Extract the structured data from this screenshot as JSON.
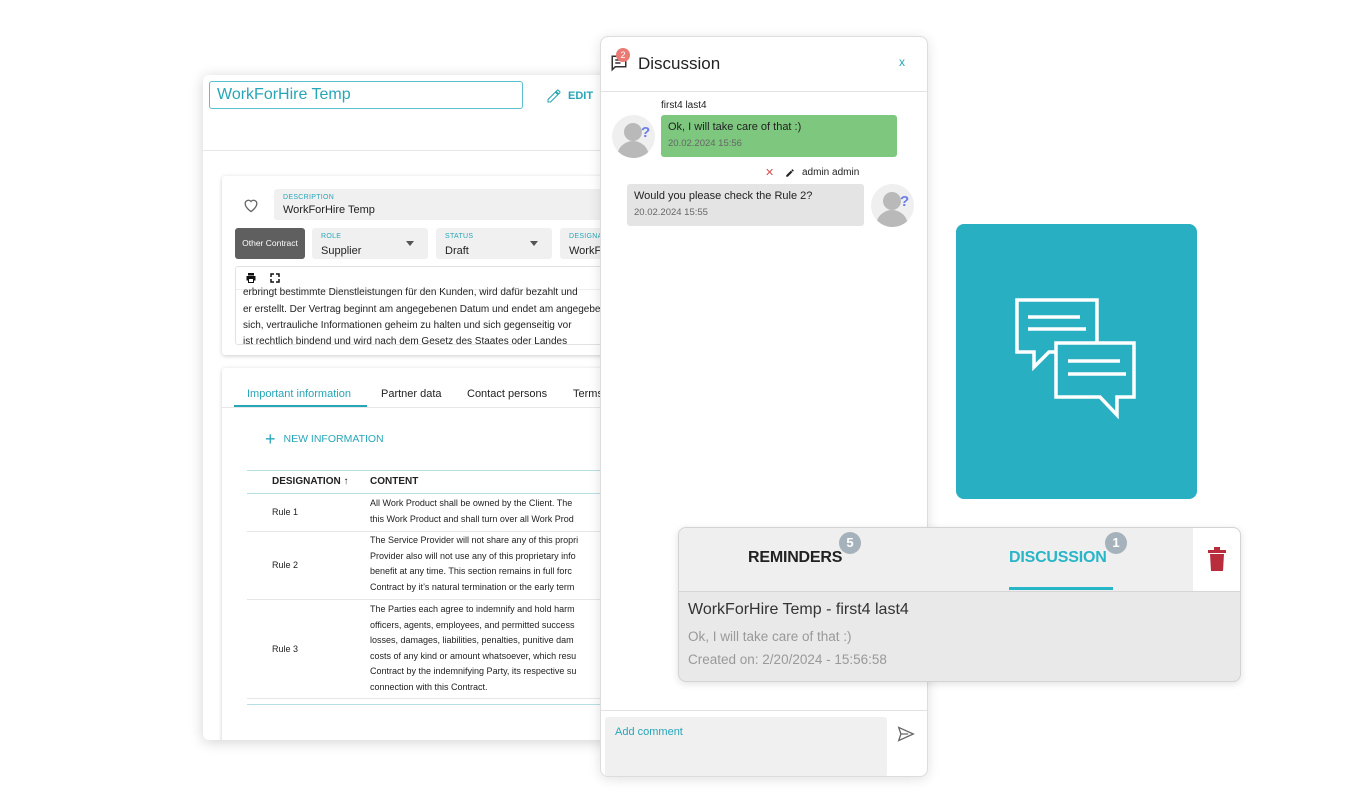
{
  "contract": {
    "title": "WorkForHire Temp",
    "edit_label": "EDIT",
    "description_label": "DESCRIPTION",
    "description_value": "WorkForHire Temp",
    "type_button": "Other Contract",
    "role_label": "ROLE",
    "role_value": "Supplier",
    "status_label": "STATUS",
    "status_value": "Draft",
    "designation_label": "DESIGNATION",
    "designation_value": "WorkForHire Temp",
    "editor_lines": [
      "erbringt bestimmte Dienstleistungen für den Kunden, wird dafür bezahlt und",
      "er erstellt. Der Vertrag beginnt am angegebenen Datum und endet am angegebenen",
      "sich, vertrauliche Informationen geheim zu halten und sich gegenseitig vor",
      "ist rechtlich bindend und wird nach dem Gesetz des Staates oder Landes"
    ],
    "tabs": [
      "Important information",
      "Partner data",
      "Contact persons",
      "Terms"
    ],
    "new_info_label": "NEW INFORMATION",
    "table": {
      "headers": [
        "DESIGNATION",
        "CONTENT"
      ],
      "rows": [
        {
          "designation": "Rule 1",
          "content": [
            "All Work Product shall be owned by the Client. The",
            "this Work Product and shall turn over all Work Prod"
          ]
        },
        {
          "designation": "Rule 2",
          "content": [
            "The Service Provider will not share any of this propri",
            "Provider also will not use any of this proprietary info",
            "benefit at any time. This section remains in full forc",
            "Contract by it’s natural termination or the early term"
          ]
        },
        {
          "designation": "Rule 3",
          "content": [
            "The Parties each agree to indemnify and hold harm",
            "officers, agents, employees, and permitted success",
            "losses, damages, liabilities, penalties, punitive dam",
            "costs of any kind or amount whatsoever, which resu",
            "Contract by the indemnifying Party, its respective su",
            "connection with this Contract."
          ]
        }
      ]
    }
  },
  "discussion": {
    "title": "Discussion",
    "badge": "2",
    "close_label": "x",
    "messages": [
      {
        "author": "first4 last4",
        "text": "Ok, I will take care of that :)",
        "time": "20.02.2024 15:56"
      },
      {
        "author": "admin admin",
        "text": "Would you please check the Rule 2?",
        "time": "20.02.2024 15:55"
      }
    ],
    "comment_placeholder": "Add comment"
  },
  "notifications": {
    "tabs": [
      {
        "label": "REMINDERS",
        "count": "5"
      },
      {
        "label": "DISCUSSION",
        "count": "1"
      }
    ],
    "item": {
      "title": "WorkForHire Temp - first4 last4",
      "message": "Ok, I will take care of that :)",
      "created": "Created on: 2/20/2024 - 15:56:58"
    }
  },
  "colors": {
    "accent": "#27a6b8",
    "tile": "#28afc2",
    "my_bubble": "#7dc77f",
    "other_bubble": "#e4e4e4",
    "trash": "#b92c3c"
  }
}
